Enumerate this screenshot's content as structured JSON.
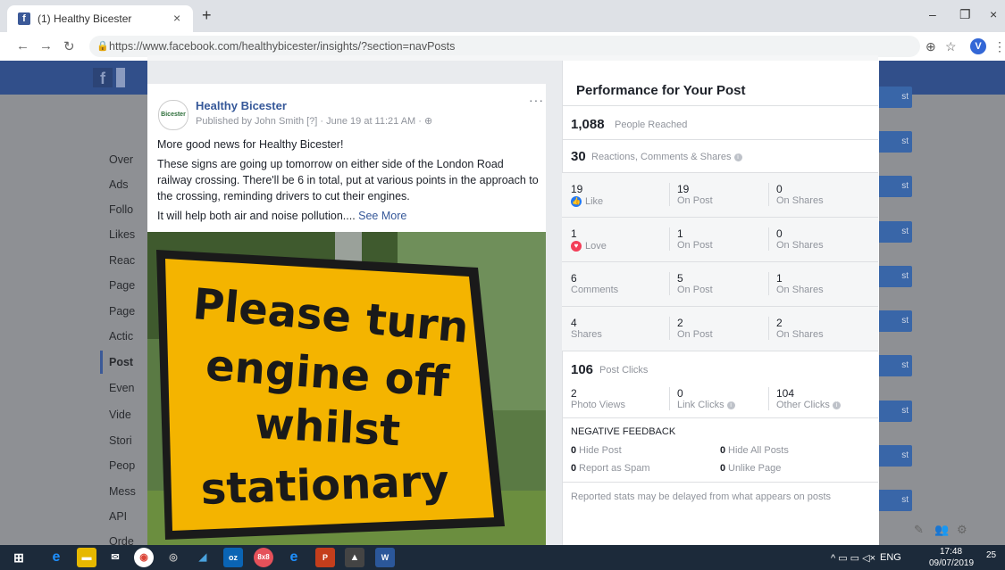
{
  "browser": {
    "tab_title": "(1) Healthy Bicester",
    "tab_close": "×",
    "new_tab": "+",
    "url": "https://www.facebook.com/healthybicester/insights/?section=navPosts",
    "avatar_letter": "V",
    "window_controls": [
      "–",
      "❐",
      "×"
    ]
  },
  "background_page": {
    "logo": "f",
    "sidebar_items": [
      "Over",
      "Ads",
      "Follo",
      "Likes",
      "Reac",
      "Page",
      "Page",
      "Actic",
      "Post",
      "Even",
      "Vide",
      "Stori",
      "Peop",
      "Mess",
      "API",
      "Orde"
    ],
    "button_labels": [
      "st",
      "st",
      "st",
      "st",
      "st",
      "st",
      "st",
      "st",
      "st",
      "st"
    ]
  },
  "post": {
    "page_name": "Healthy Bicester",
    "logo_text": "Bicester",
    "publisher": "Published by John Smith [?] · June 19 at 11:21 AM · ",
    "more": "···",
    "line1": "More good news for Healthy Bicester!",
    "line2": "These signs are going up tomorrow on either side of the London Road railway crossing. There'll be 6 in total, put at various points in the approach to the crossing, reminding drivers to cut their engines.",
    "line3": "It will help both air and noise pollution.... ",
    "see_more": "See More",
    "sign_lines": [
      "Please turn",
      "engine off",
      "whilst",
      "stationary"
    ]
  },
  "insights": {
    "title": "Performance for Your Post",
    "reached_num": "1,088",
    "reached_label": "People Reached",
    "rcs_num": "30",
    "rcs_label": "Reactions, Comments & Shares",
    "rows": [
      {
        "num": "19",
        "label": "Like",
        "post_num": "19",
        "post_label": "On Post",
        "shares_num": "0",
        "shares_label": "On Shares"
      },
      {
        "num": "1",
        "label": "Love",
        "post_num": "1",
        "post_label": "On Post",
        "shares_num": "0",
        "shares_label": "On Shares"
      },
      {
        "num": "6",
        "label": "Comments",
        "post_num": "5",
        "post_label": "On Post",
        "shares_num": "1",
        "shares_label": "On Shares"
      },
      {
        "num": "4",
        "label": "Shares",
        "post_num": "2",
        "post_label": "On Post",
        "shares_num": "2",
        "shares_label": "On Shares"
      }
    ],
    "clicks_num": "106",
    "clicks_label": "Post Clicks",
    "clicks": [
      {
        "num": "2",
        "label": "Photo Views"
      },
      {
        "num": "0",
        "label": "Link Clicks"
      },
      {
        "num": "104",
        "label": "Other Clicks"
      }
    ],
    "negative_title": "NEGATIVE FEEDBACK",
    "negative": [
      {
        "num": "0",
        "label": "Hide Post"
      },
      {
        "num": "0",
        "label": "Hide All Posts"
      },
      {
        "num": "0",
        "label": "Report as Spam"
      },
      {
        "num": "0",
        "label": "Unlike Page"
      }
    ],
    "footnote": "Reported stats may be delayed from what appears on posts"
  },
  "taskbar": {
    "lang": "ENG",
    "time": "17:48",
    "date": "09/07/2019",
    "notif": "25"
  },
  "colors": {
    "facebook_blue": "#3b5998",
    "link_blue": "#365899",
    "sign_yellow": "#f4b400",
    "like_blue": "#2078f4",
    "love_red": "#f33e58"
  }
}
